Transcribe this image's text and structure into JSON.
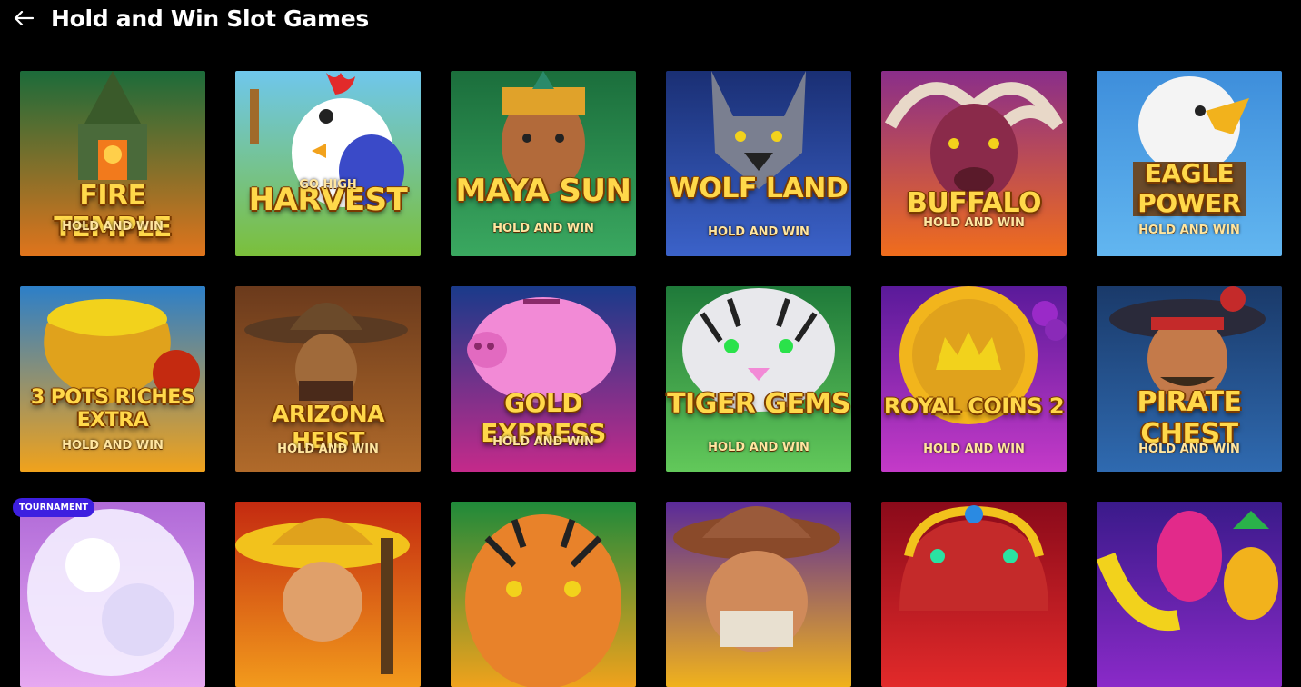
{
  "header": {
    "title": "Hold and Win Slot Games"
  },
  "games": [
    {
      "name": "FIRE TEMPLE",
      "subtitle": "HOLD AND WIN",
      "bg": [
        "#1c6b3a",
        "#e0741c"
      ],
      "accent": "#ffb238",
      "titleTop": 120,
      "titleSize": 30,
      "subTop": 164,
      "art": "temple"
    },
    {
      "name": "HARVEST",
      "subtitle": "GO HIGH",
      "bg": [
        "#6fc7ec",
        "#7bbf3a"
      ],
      "accent": "#ffffff",
      "titleTop": 122,
      "titleSize": 34,
      "subTop": 118,
      "art": "chicken"
    },
    {
      "name": "MAYA SUN",
      "subtitle": "HOLD AND WIN",
      "bg": [
        "#1b6e3c",
        "#3aa860"
      ],
      "accent": "#d9a23a",
      "titleTop": 112,
      "titleSize": 34,
      "subTop": 166,
      "art": "maya"
    },
    {
      "name": "WOLF LAND",
      "subtitle": "HOLD AND WIN",
      "bg": [
        "#1a2f74",
        "#3b62c9"
      ],
      "accent": "#8a8fa0",
      "titleTop": 112,
      "titleSize": 30,
      "subTop": 170,
      "art": "wolf"
    },
    {
      "name": "BUFFALO",
      "subtitle": "HOLD AND WIN",
      "bg": [
        "#8a2e8a",
        "#f06d1c"
      ],
      "accent": "#7a2a4a",
      "titleTop": 128,
      "titleSize": 30,
      "subTop": 160,
      "art": "buffalo"
    },
    {
      "name": "EAGLE POWER",
      "subtitle": "HOLD AND WIN",
      "bg": [
        "#3e8edb",
        "#62b6f0"
      ],
      "accent": "#f4f4f4",
      "titleTop": 96,
      "titleSize": 28,
      "subTop": 168,
      "art": "eagle"
    },
    {
      "name": "3 POTS RICHES EXTRA",
      "subtitle": "HOLD AND WIN",
      "bg": [
        "#2d7fc8",
        "#f0a21c"
      ],
      "accent": "#f2b51c",
      "titleTop": 110,
      "titleSize": 22,
      "subTop": 168,
      "art": "pots"
    },
    {
      "name": "ARIZONA HEIST",
      "subtitle": "HOLD AND WIN",
      "bg": [
        "#6b3a1c",
        "#b06a2a"
      ],
      "accent": "#5a3a22",
      "titleTop": 126,
      "titleSize": 25,
      "subTop": 172,
      "art": "cowboy"
    },
    {
      "name": "GOLD EXPRESS",
      "subtitle": "HOLD AND WIN",
      "bg": [
        "#1a3a8a",
        "#c42a8a"
      ],
      "accent": "#f28ad6",
      "titleTop": 112,
      "titleSize": 28,
      "subTop": 164,
      "art": "piggy"
    },
    {
      "name": "TIGER GEMS",
      "subtitle": "HOLD AND WIN",
      "bg": [
        "#1f7a3a",
        "#62c85a"
      ],
      "accent": "#e8e8ec",
      "titleTop": 112,
      "titleSize": 30,
      "subTop": 170,
      "art": "tiger"
    },
    {
      "name": "ROYAL COINS 2",
      "subtitle": "HOLD AND WIN",
      "bg": [
        "#5a1a9a",
        "#c43ac8"
      ],
      "accent": "#f2b51c",
      "titleTop": 118,
      "titleSize": 24,
      "subTop": 172,
      "art": "coin"
    },
    {
      "name": "PIRATE CHEST",
      "subtitle": "HOLD AND WIN",
      "bg": [
        "#1a3a6a",
        "#2f6ab0"
      ],
      "accent": "#8a3a2a",
      "titleTop": 110,
      "titleSize": 30,
      "subTop": 172,
      "art": "pirate"
    },
    {
      "name": "",
      "subtitle": "",
      "bg": [
        "#b06ad8",
        "#e6a8f0"
      ],
      "accent": "#f4f0ff",
      "titleTop": 0,
      "titleSize": 0,
      "subTop": 0,
      "art": "pearl",
      "badge": "TOURNAMENT"
    },
    {
      "name": "",
      "subtitle": "",
      "bg": [
        "#c42a10",
        "#f29a1c"
      ],
      "accent": "#f2c21c",
      "titleTop": 0,
      "titleSize": 0,
      "subTop": 0,
      "art": "mexican"
    },
    {
      "name": "",
      "subtitle": "",
      "bg": [
        "#1f8a3a",
        "#f0a21c"
      ],
      "accent": "#e8822a",
      "titleTop": 0,
      "titleSize": 0,
      "subTop": 0,
      "art": "tiger2"
    },
    {
      "name": "",
      "subtitle": "",
      "bg": [
        "#5a2a9a",
        "#f0b21c"
      ],
      "accent": "#8a4a2a",
      "titleTop": 0,
      "titleSize": 0,
      "subTop": 0,
      "art": "miner"
    },
    {
      "name": "",
      "subtitle": "",
      "bg": [
        "#8a0a1a",
        "#e22a2a"
      ],
      "accent": "#f2c21c",
      "titleTop": 0,
      "titleSize": 0,
      "subTop": 0,
      "art": "crown"
    },
    {
      "name": "",
      "subtitle": "",
      "bg": [
        "#3a1a8a",
        "#8a2ac8"
      ],
      "accent": "#f2d21c",
      "titleTop": 0,
      "titleSize": 0,
      "subTop": 0,
      "art": "fruit"
    }
  ]
}
